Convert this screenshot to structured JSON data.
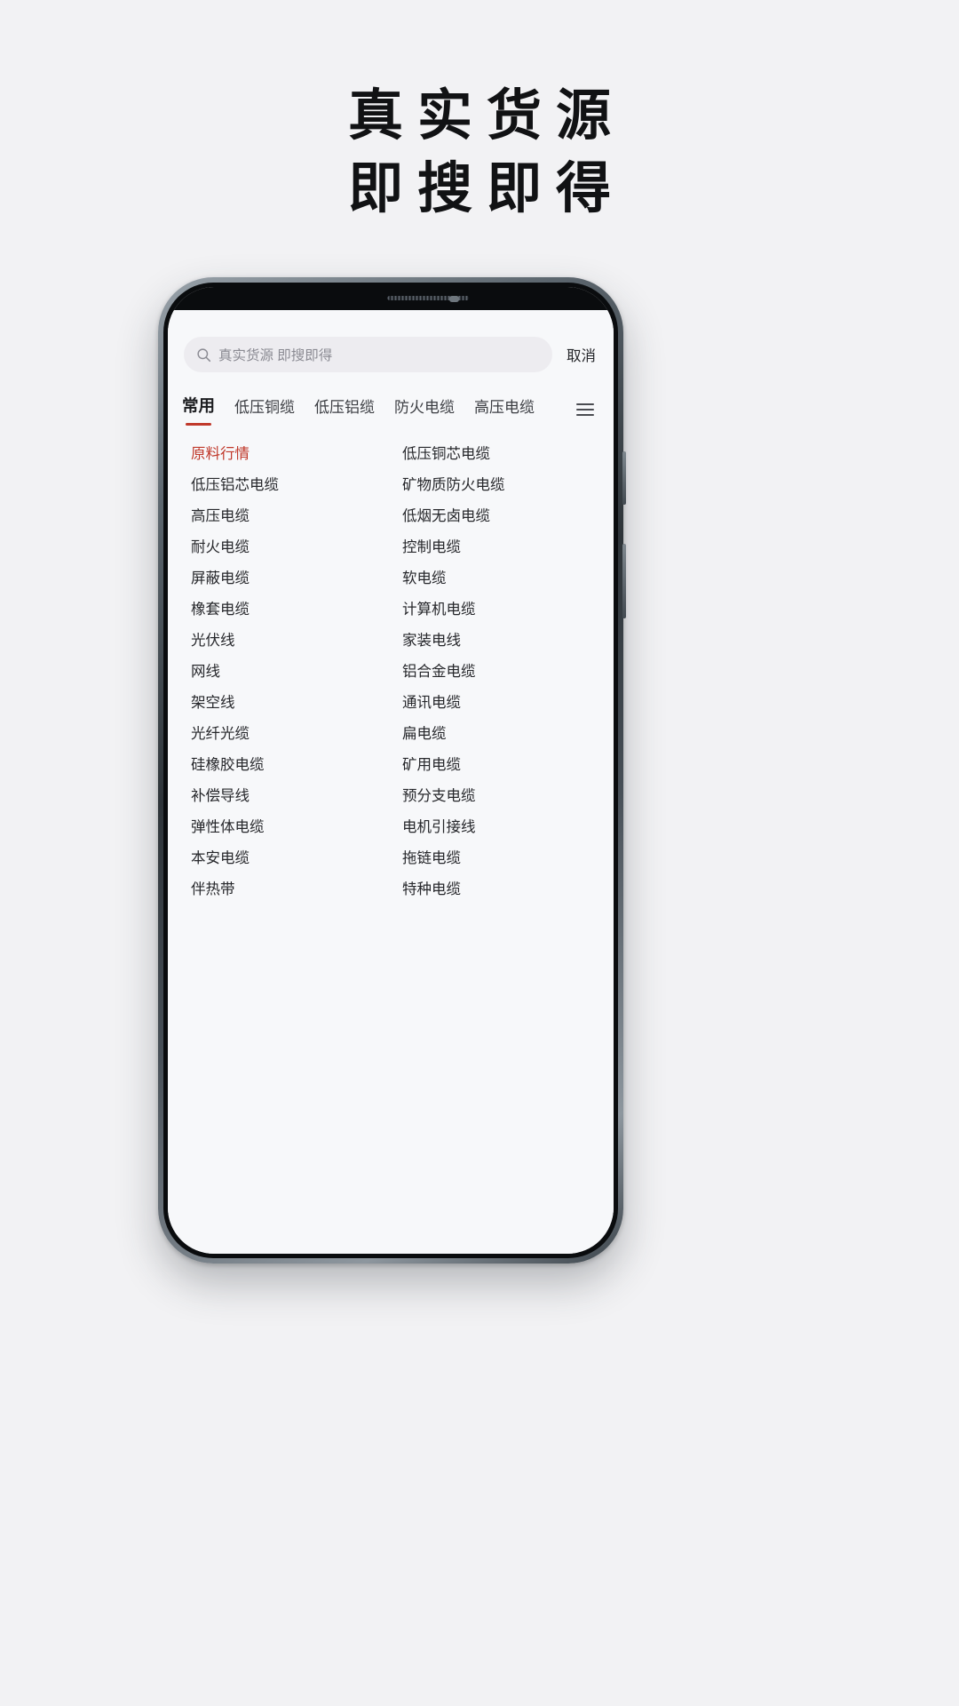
{
  "headline": {
    "line1": "真实货源",
    "line2": "即搜即得"
  },
  "phone": {
    "status": {
      "speaker": "speaker-grille",
      "camera": "front-camera"
    }
  },
  "app": {
    "search": {
      "icon": "search-icon",
      "value": "",
      "placeholder": "真实货源 即搜即得",
      "cancel_label": "取消"
    },
    "tabs": {
      "more_icon": "list-menu-icon",
      "items": [
        {
          "label": "常用",
          "active": true
        },
        {
          "label": "低压铜缆",
          "active": false
        },
        {
          "label": "低压铝缆",
          "active": false
        },
        {
          "label": "防火电缆",
          "active": false
        },
        {
          "label": "高压电缆",
          "active": false
        }
      ]
    },
    "categories": [
      {
        "label": "原料行情",
        "highlight": true
      },
      {
        "label": "低压铜芯电缆",
        "highlight": false
      },
      {
        "label": "低压铝芯电缆",
        "highlight": false
      },
      {
        "label": "矿物质防火电缆",
        "highlight": false
      },
      {
        "label": "高压电缆",
        "highlight": false
      },
      {
        "label": "低烟无卤电缆",
        "highlight": false
      },
      {
        "label": "耐火电缆",
        "highlight": false
      },
      {
        "label": "控制电缆",
        "highlight": false
      },
      {
        "label": "屏蔽电缆",
        "highlight": false
      },
      {
        "label": "软电缆",
        "highlight": false
      },
      {
        "label": "橡套电缆",
        "highlight": false
      },
      {
        "label": "计算机电缆",
        "highlight": false
      },
      {
        "label": "光伏线",
        "highlight": false
      },
      {
        "label": "家装电线",
        "highlight": false
      },
      {
        "label": "网线",
        "highlight": false
      },
      {
        "label": "铝合金电缆",
        "highlight": false
      },
      {
        "label": "架空线",
        "highlight": false
      },
      {
        "label": "通讯电缆",
        "highlight": false
      },
      {
        "label": "光纤光缆",
        "highlight": false
      },
      {
        "label": "扁电缆",
        "highlight": false
      },
      {
        "label": "硅橡胶电缆",
        "highlight": false
      },
      {
        "label": "矿用电缆",
        "highlight": false
      },
      {
        "label": "补偿导线",
        "highlight": false
      },
      {
        "label": "预分支电缆",
        "highlight": false
      },
      {
        "label": "弹性体电缆",
        "highlight": false
      },
      {
        "label": "电机引接线",
        "highlight": false
      },
      {
        "label": "本安电缆",
        "highlight": false
      },
      {
        "label": "拖链电缆",
        "highlight": false
      },
      {
        "label": "伴热带",
        "highlight": false
      },
      {
        "label": "特种电缆",
        "highlight": false
      }
    ]
  },
  "colors": {
    "page_bg": "#f2f2f4",
    "screen_bg": "#f7f8fa",
    "accent_red": "#c0392b",
    "search_bg": "#edecf0",
    "text_primary": "#26272b",
    "text_muted": "#8b8b93"
  }
}
